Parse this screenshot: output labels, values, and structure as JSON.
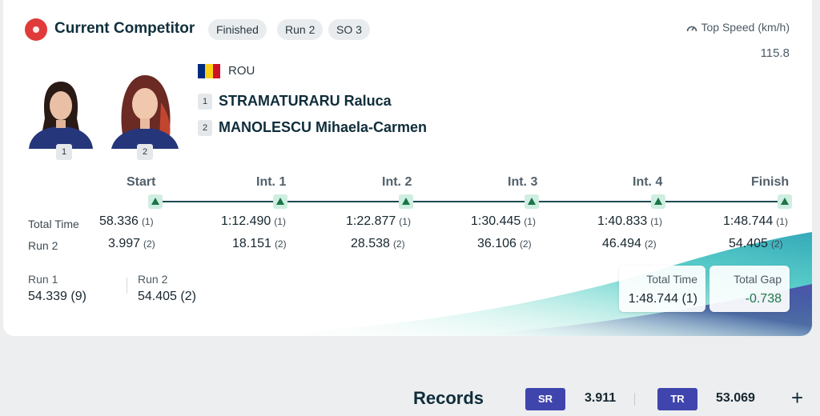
{
  "header": {
    "title": "Current Competitor",
    "badges": [
      "Finished",
      "Run 2",
      "SO 3"
    ],
    "top_speed_label": "Top Speed (km/h)",
    "top_speed_value": "115.8"
  },
  "team": {
    "country": "ROU",
    "flag_colors": [
      "#002B7F",
      "#FCD116",
      "#CE1126"
    ],
    "athletes": [
      {
        "num": "1",
        "name": "STRAMATURARU Raluca"
      },
      {
        "num": "2",
        "name": "MANOLESCU Mihaela-Carmen"
      }
    ]
  },
  "splits": {
    "labels": [
      "Start",
      "Int. 1",
      "Int. 2",
      "Int. 3",
      "Int. 4",
      "Finish"
    ],
    "rows": [
      {
        "label": "Total Time",
        "cells": [
          {
            "time": "58.336",
            "rank": "(1)"
          },
          {
            "time": "1:12.490",
            "rank": "(1)"
          },
          {
            "time": "1:22.877",
            "rank": "(1)"
          },
          {
            "time": "1:30.445",
            "rank": "(1)"
          },
          {
            "time": "1:40.833",
            "rank": "(1)"
          },
          {
            "time": "1:48.744",
            "rank": "(1)"
          }
        ]
      },
      {
        "label": "Run 2",
        "cells": [
          {
            "time": "3.997",
            "rank": "(2)"
          },
          {
            "time": "18.151",
            "rank": "(2)"
          },
          {
            "time": "28.538",
            "rank": "(2)"
          },
          {
            "time": "36.106",
            "rank": "(2)"
          },
          {
            "time": "46.494",
            "rank": "(2)"
          },
          {
            "time": "54.405",
            "rank": "(2)"
          }
        ]
      }
    ]
  },
  "runs": {
    "run1_label": "Run 1",
    "run1_value": "54.339 (9)",
    "run2_label": "Run 2",
    "run2_value": "54.405 (2)"
  },
  "totals": {
    "total_time_label": "Total Time",
    "total_time_value": "1:48.744 (1)",
    "total_gap_label": "Total Gap",
    "total_gap_value": "-0.738",
    "gap_color": "#1c7a4a"
  },
  "records": {
    "title": "Records",
    "items": [
      {
        "code": "SR",
        "value": "3.911"
      },
      {
        "code": "TR",
        "value": "53.069"
      }
    ],
    "expand_symbol": "+"
  },
  "colors": {
    "accent_red": "#e03a3a",
    "badge_blue": "#3f45ad"
  }
}
